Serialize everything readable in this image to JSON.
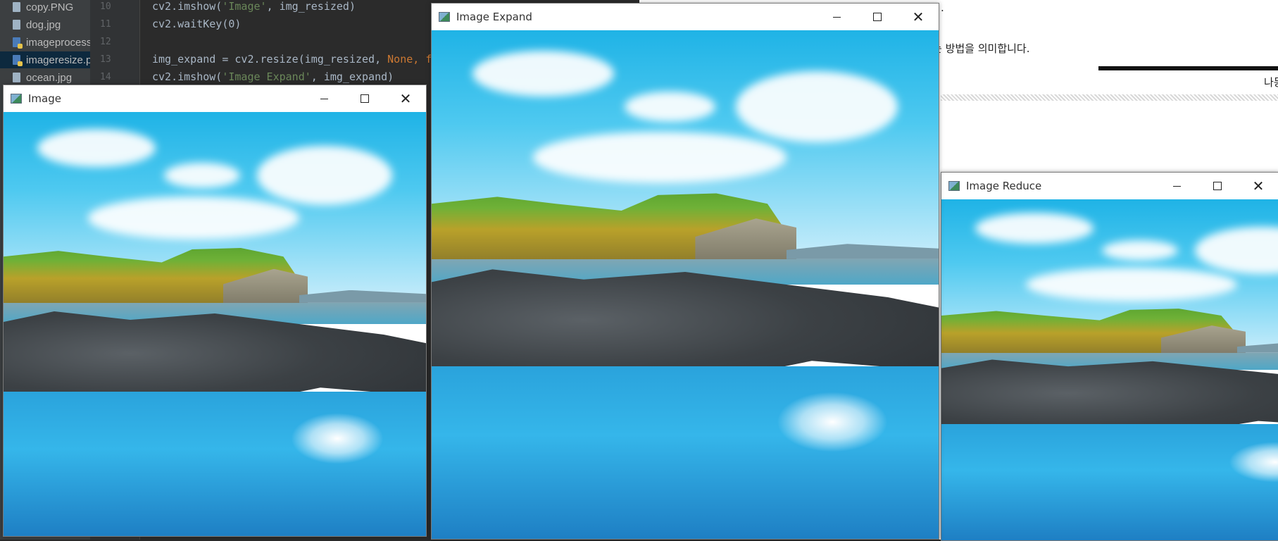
{
  "ide": {
    "files": [
      {
        "name": "copy.PNG",
        "type": "image"
      },
      {
        "name": "dog.jpg",
        "type": "image"
      },
      {
        "name": "imageprocessin",
        "type": "python"
      },
      {
        "name": "imageresize.py",
        "type": "python",
        "selected": true
      },
      {
        "name": "ocean.jpg",
        "type": "image"
      }
    ],
    "lines": [
      {
        "no": "10",
        "pre": "cv2.imshow(",
        "str": "'Image'",
        "post": ", img_resized)"
      },
      {
        "no": "11",
        "pre": "cv2.waitKey(0)",
        "str": "",
        "post": ""
      },
      {
        "no": "12",
        "pre": "",
        "str": "",
        "post": ""
      },
      {
        "no": "13",
        "pre": "img_expand = cv2.resize(img_resized, ",
        "kw": "None, f",
        "post": ""
      },
      {
        "no": "14",
        "pre": "cv2.imshow(",
        "str": "'Image Expand'",
        "post": ", img_expand)"
      }
    ]
  },
  "document": {
    "line1": ".",
    "line2": "는 방법을 의미합니다.",
    "line3": "나등"
  },
  "windows": {
    "image": {
      "title": "Image"
    },
    "expand": {
      "title": "Image Expand"
    },
    "reduce": {
      "title": "Image Reduce"
    }
  },
  "icons": {
    "minimize": "minimize-icon",
    "maximize": "maximize-icon",
    "close": "close-icon",
    "close_glyph": "✕"
  }
}
